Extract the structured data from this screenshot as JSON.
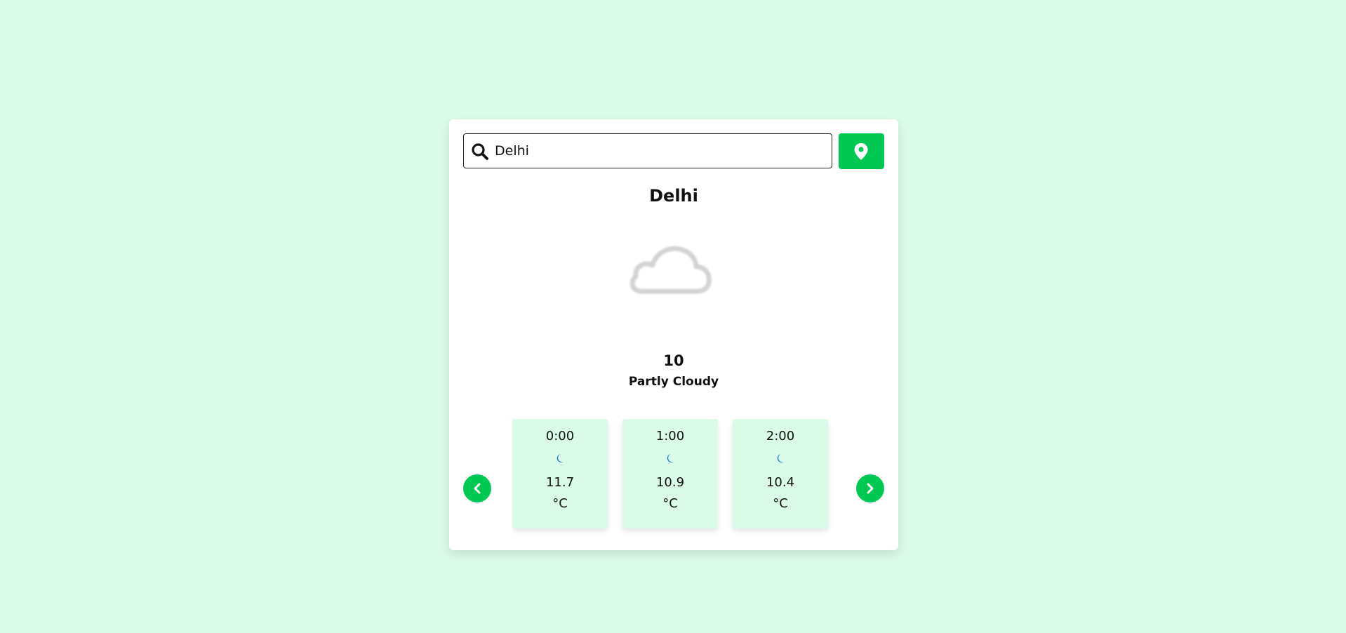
{
  "search": {
    "value": "Delhi",
    "placeholder": ""
  },
  "icons": {
    "search": "search-icon",
    "location": "location-pin-icon",
    "current_weather": "partly-cloudy-night-icon",
    "hourly": "moon-icon",
    "prev": "chevron-left-icon",
    "next": "chevron-right-icon"
  },
  "current": {
    "city": "Delhi",
    "temperature": "10",
    "condition": "Partly Cloudy"
  },
  "hourly": [
    {
      "time": "0:00",
      "temp": "11.7",
      "unit": "°C"
    },
    {
      "time": "1:00",
      "temp": "10.9",
      "unit": "°C"
    },
    {
      "time": "2:00",
      "temp": "10.4",
      "unit": "°C"
    }
  ],
  "colors": {
    "background": "#dafbe8",
    "accent": "#00c853",
    "card": "#ffffff",
    "moon": "#1677d2",
    "cloud": "#d3d3d3"
  }
}
